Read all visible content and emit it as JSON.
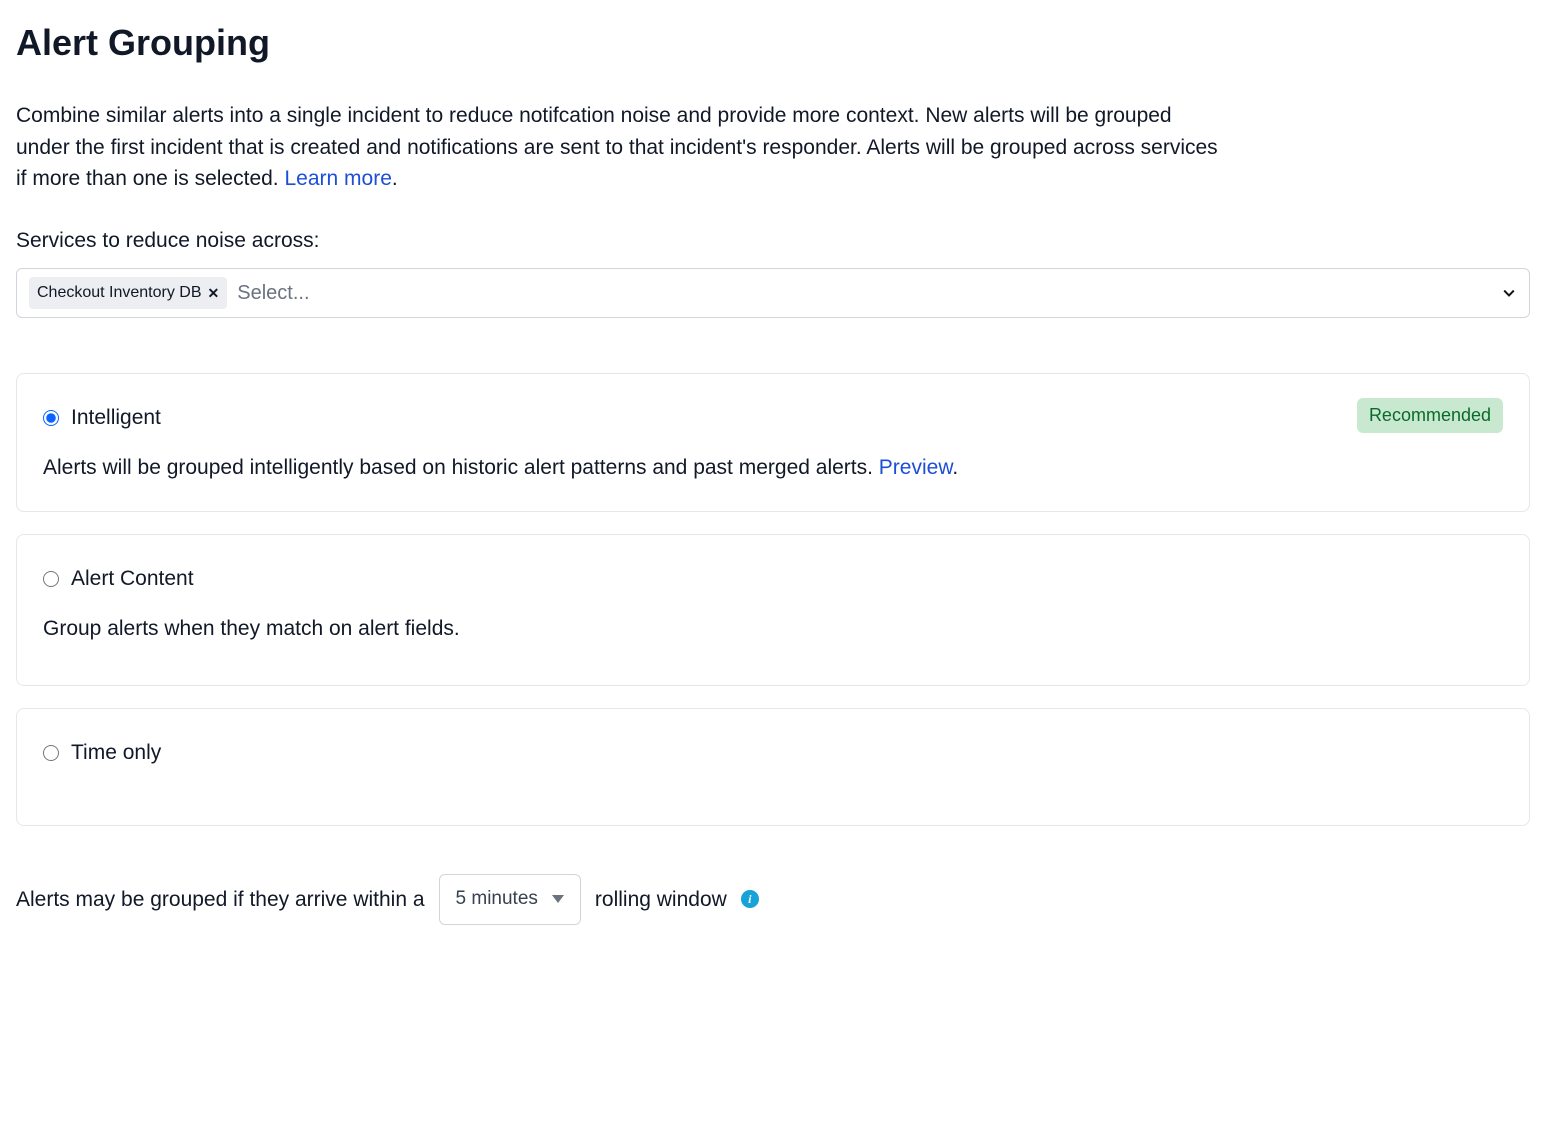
{
  "header": {
    "title": "Alert Grouping",
    "description_prefix": "Combine similar alerts into a single incident to reduce notifcation noise and provide more context. New alerts will be grouped under the first incident that is created and notifications are sent to that incident's responder. Alerts will be grouped across services if more than one is selected. ",
    "learn_more": "Learn more",
    "description_suffix": "."
  },
  "services": {
    "label": "Services to reduce noise across:",
    "selected": [
      "Checkout Inventory DB"
    ],
    "placeholder": "Select..."
  },
  "options": {
    "intelligent": {
      "title": "Intelligent",
      "badge": "Recommended",
      "body_prefix": "Alerts will be grouped intelligently based on historic alert patterns and past merged alerts. ",
      "preview": "Preview",
      "body_suffix": ".",
      "selected": true
    },
    "alert_content": {
      "title": "Alert Content",
      "body": "Group alerts when they match on alert fields.",
      "selected": false
    },
    "time_only": {
      "title": "Time only",
      "selected": false
    }
  },
  "rolling": {
    "prefix": "Alerts may be grouped if they arrive within a",
    "window_value": "5 minutes",
    "suffix": "rolling window"
  }
}
